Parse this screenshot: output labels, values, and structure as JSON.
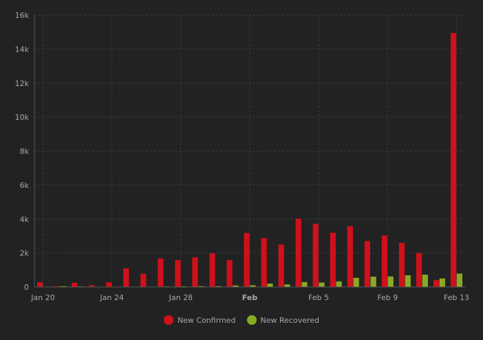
{
  "colors": {
    "background": "#222222",
    "grid": "#3d3d3d",
    "axis_text": "#a8a8a8",
    "confirmed": "#d0101b",
    "recovered": "#89a926"
  },
  "chart_data": {
    "type": "bar",
    "title": "",
    "xlabel": "",
    "ylabel": "",
    "ylim": [
      0,
      16000
    ],
    "y_ticks": [
      {
        "value": 0,
        "label": "0"
      },
      {
        "value": 2000,
        "label": "2k"
      },
      {
        "value": 4000,
        "label": "4k"
      },
      {
        "value": 6000,
        "label": "6k"
      },
      {
        "value": 8000,
        "label": "8k"
      },
      {
        "value": 10000,
        "label": "10k"
      },
      {
        "value": 12000,
        "label": "12k"
      },
      {
        "value": 14000,
        "label": "14k"
      },
      {
        "value": 16000,
        "label": "16k"
      }
    ],
    "x_ticks": [
      {
        "index": 0,
        "label": "Jan 20",
        "bold": false
      },
      {
        "index": 4,
        "label": "Jan 24",
        "bold": false
      },
      {
        "index": 8,
        "label": "Jan 28",
        "bold": false
      },
      {
        "index": 12,
        "label": "Feb",
        "bold": true
      },
      {
        "index": 16,
        "label": "Feb 5",
        "bold": false
      },
      {
        "index": 20,
        "label": "Feb 9",
        "bold": false
      },
      {
        "index": 24,
        "label": "Feb 13",
        "bold": false
      }
    ],
    "categories": [
      "Jan 20",
      "Jan 21",
      "Jan 22",
      "Jan 23",
      "Jan 24",
      "Jan 25",
      "Jan 26",
      "Jan 27",
      "Jan 28",
      "Jan 29",
      "Jan 30",
      "Jan 31",
      "Feb 1",
      "Feb 2",
      "Feb 3",
      "Feb 4",
      "Feb 5",
      "Feb 6",
      "Feb 7",
      "Feb 8",
      "Feb 9",
      "Feb 10",
      "Feb 11",
      "Feb 12",
      "Feb 13"
    ],
    "series": [
      {
        "name": "New Confirmed",
        "color": "#d0101b",
        "values": [
          280,
          50,
          250,
          100,
          280,
          1100,
          780,
          1680,
          1580,
          1750,
          1980,
          1580,
          3180,
          2880,
          2500,
          4020,
          3720,
          3200,
          3580,
          2700,
          3030,
          2600,
          2000,
          410,
          14950
        ]
      },
      {
        "name": "New Recovered",
        "color": "#89a926",
        "values": [
          0,
          50,
          30,
          0,
          10,
          0,
          0,
          30,
          40,
          50,
          50,
          90,
          100,
          200,
          150,
          290,
          260,
          330,
          540,
          610,
          620,
          690,
          730,
          500,
          790
        ]
      }
    ],
    "grid": true,
    "legend_position": "bottom-center"
  }
}
